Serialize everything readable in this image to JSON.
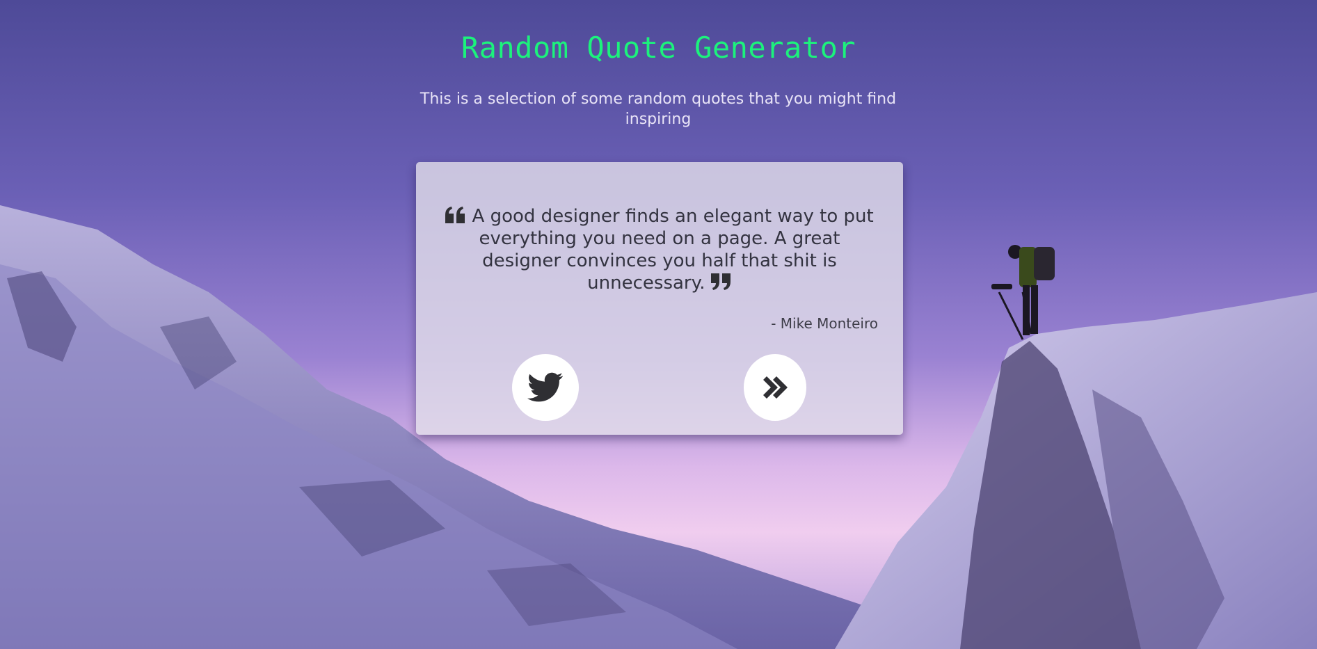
{
  "header": {
    "title": "Random Quote Generator",
    "subtitle": "This is a selection of some random quotes that you might find inspiring"
  },
  "quote": {
    "text": "A good designer finds an elegant way to put everything you need on a page. A great designer convinces you half that shit is unnecessary.",
    "author": "- Mike Monteiro"
  },
  "icons": {
    "open_quote": "quote-left-icon",
    "close_quote": "quote-right-icon",
    "tweet": "twitter-icon",
    "next": "double-chevron-right-icon"
  },
  "colors": {
    "title": "#1cf27c",
    "subtitle": "#e9e4f7",
    "quote_text": "#333340",
    "card_bg": "#e2deea",
    "button_bg": "#ffffff",
    "icon": "#2f2f33"
  }
}
